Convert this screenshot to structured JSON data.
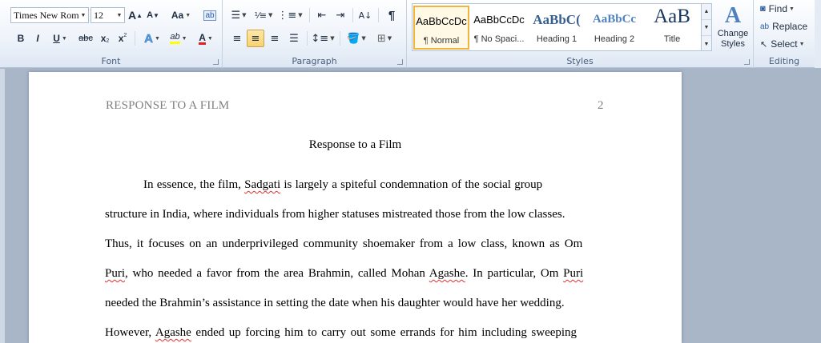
{
  "ribbon": {
    "font": {
      "label": "Font",
      "font_name": "Times New Rom",
      "font_size": "12",
      "grow_font": "A",
      "shrink_font": "A",
      "change_case": "Aa",
      "bold": "B",
      "italic": "I",
      "underline": "U",
      "strikethrough": "abc",
      "subscript": "x",
      "superscript": "x",
      "text_effects": "A",
      "highlight": "ab",
      "font_color": "A"
    },
    "paragraph": {
      "label": "Paragraph",
      "show_marks": "¶"
    },
    "styles": {
      "label": "Styles",
      "items": [
        {
          "preview": "AaBbCcDc",
          "name": "¶ Normal"
        },
        {
          "preview": "AaBbCcDc",
          "name": "¶ No Spaci..."
        },
        {
          "preview": "AaBbC(",
          "name": "Heading 1"
        },
        {
          "preview": "AaBbCc",
          "name": "Heading 2"
        },
        {
          "preview": "AaB",
          "name": "Title"
        }
      ],
      "change_styles": "Change Styles"
    },
    "editing": {
      "label": "Editing",
      "find": "Find",
      "replace": "Replace",
      "select": "Select"
    }
  },
  "document": {
    "header_title": "RESPONSE TO A FILM",
    "page_number": "2",
    "title": "Response to a Film",
    "lines": [
      [
        "In essence, the film, ",
        "Sadgati",
        " is largely a spiteful condemnation of the social group"
      ],
      [
        "structure in India, where individuals from higher statuses mistreated those from the low classes."
      ],
      [
        "Thus, it focuses on an underprivileged community shoemaker from a low class, known as Om"
      ],
      [
        "",
        "Puri",
        ", who needed a favor from the area Brahmin, called Mohan ",
        "Agashe",
        ". In particular, Om ",
        "Puri"
      ],
      [
        "needed the Brahmin’s assistance in setting the date when his daughter would have her wedding."
      ],
      [
        "However, ",
        "Agashe",
        " ended up forcing him to carry out some errands for him including sweeping"
      ]
    ]
  },
  "colors": {
    "ribbon_bg": "#eef3fa",
    "workspace_bg": "#a9b6c8",
    "active_button": "#f8d270",
    "heading_style_blue": "#365f91",
    "spell_squiggle": "#e03030"
  }
}
